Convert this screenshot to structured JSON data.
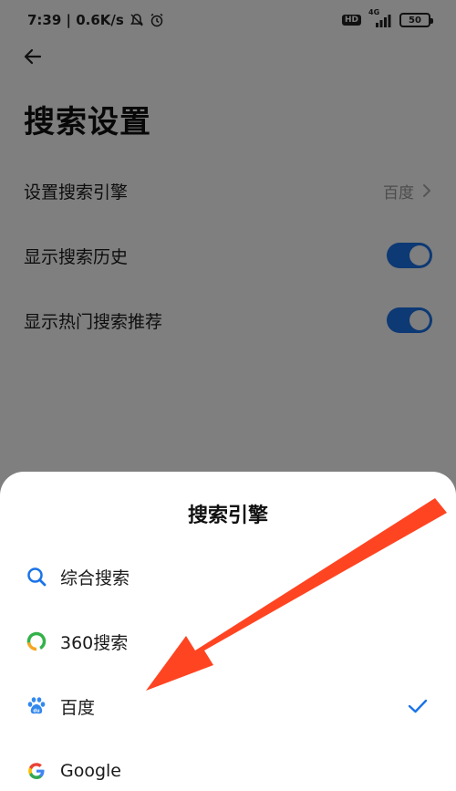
{
  "status_bar": {
    "time_speed": "7:39 | 0.6K/s",
    "hd": "HD",
    "network": "4G",
    "battery": "50"
  },
  "page": {
    "title": "搜索设置"
  },
  "settings": {
    "engine": {
      "label": "设置搜索引擎",
      "value": "百度"
    },
    "history": {
      "label": "显示搜索历史",
      "on": true
    },
    "hot": {
      "label": "显示热门搜索推荐",
      "on": true
    }
  },
  "sheet": {
    "title": "搜索引擎",
    "options": [
      {
        "label": "综合搜索",
        "icon": "search-icon",
        "selected": false
      },
      {
        "label": "360搜索",
        "icon": "360-logo-icon",
        "selected": false
      },
      {
        "label": "百度",
        "icon": "baidu-paw-icon",
        "selected": true
      },
      {
        "label": "Google",
        "icon": "google-g-icon",
        "selected": false
      }
    ]
  },
  "colors": {
    "accent": "#1a73e8",
    "arrow": "#ff4422",
    "check": "#1a73e8"
  }
}
